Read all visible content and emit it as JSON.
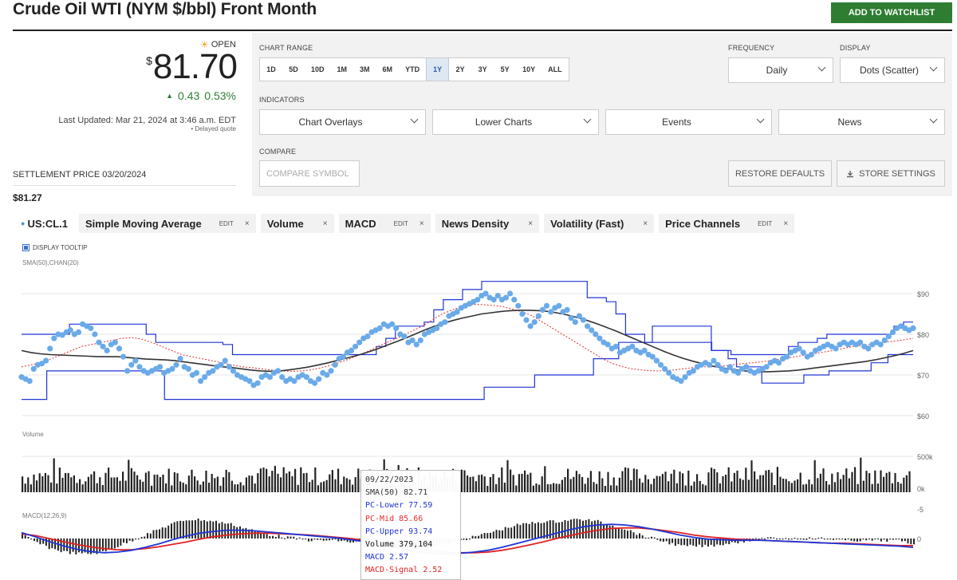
{
  "header": {
    "title": "Crude Oil WTI (NYM $/bbl) Front Month",
    "watchlist_label": "ADD TO WATCHLIST"
  },
  "quote": {
    "status": "OPEN",
    "currency": "$",
    "price": "81.70",
    "change": "0.43",
    "change_pct": "0.53%",
    "updated": "Last Updated: Mar 21, 2024 at 3:46 a.m. EDT",
    "delayed": "Delayed quote",
    "settlement_label": "SETTLEMENT PRICE 03/20/2024",
    "settlement_value": "$81.27"
  },
  "panel": {
    "chart_range_label": "CHART RANGE",
    "ranges": [
      "1D",
      "5D",
      "10D",
      "1M",
      "3M",
      "6M",
      "YTD",
      "1Y",
      "2Y",
      "3Y",
      "5Y",
      "10Y",
      "ALL"
    ],
    "selected_range": "1Y",
    "frequency_label": "FREQUENCY",
    "frequency_value": "Daily",
    "display_label": "DISPLAY",
    "display_value": "Dots (Scatter)",
    "indicators_label": "INDICATORS",
    "indicators": [
      "Chart Overlays",
      "Lower Charts",
      "Events",
      "News"
    ],
    "compare_label": "COMPARE",
    "compare_placeholder": "COMPARE SYMBOL",
    "restore_label": "RESTORE DEFAULTS",
    "store_label": "STORE SETTINGS"
  },
  "legend": {
    "symbol": "US:CL.1",
    "items": [
      {
        "label": "Simple Moving Average",
        "edit": true
      },
      {
        "label": "Volume",
        "edit": false
      },
      {
        "label": "MACD",
        "edit": true
      },
      {
        "label": "News Density",
        "edit": false
      },
      {
        "label": "Volatility (Fast)",
        "edit": false
      },
      {
        "label": "Price Channels",
        "edit": true
      }
    ],
    "edit_label": "EDIT",
    "close_label": "×"
  },
  "tooltip_toggle": "DISPLAY TOOLTIP",
  "panes": {
    "price_label": "SMA(50),CHAN(20)",
    "volume_label": "Volume",
    "macd_label": "MACD(12,26,9)"
  },
  "tooltip": {
    "date": "09/22/2023",
    "sma": "SMA(50)  82.71",
    "pc_lower": "PC-Lower  77.59",
    "pc_mid": "PC-Mid  85.66",
    "pc_upper": "PC-Upper  93.74",
    "volume": "Volume  379,104",
    "macd": "MACD  2.57",
    "macd_signal": "MACD-Signal  2.52"
  },
  "colors": {
    "accent_green": "#2e7d32",
    "dots": "#6aaae8",
    "channel": "#1f35d6",
    "mid": "#e03030",
    "sma": "#333333",
    "macd": "#1f35d6",
    "signal": "#e02020"
  },
  "chart_data": [
    {
      "type": "scatter",
      "title": "SMA(50),CHAN(20)",
      "ylim": [
        60,
        95
      ],
      "y_ticks": [
        "$90",
        "$80",
        "$70",
        "$60"
      ],
      "y_tick_values": [
        90,
        80,
        70,
        60
      ],
      "series": [
        {
          "values": [
            69.5,
            69.0,
            68.5,
            71.5,
            72.5,
            72.8,
            73.5,
            76.5,
            79.0,
            80.0,
            79.8,
            80.5,
            81.0,
            80.0,
            80.5,
            82.5,
            82.0,
            81.5,
            80.0,
            78.0,
            77.0,
            76.0,
            77.5,
            78.0,
            76.5,
            74.5,
            71.0,
            72.5,
            73.5,
            72.0,
            71.0,
            70.5,
            71.0,
            71.5,
            72.0,
            70.5,
            71.0,
            71.5,
            72.5,
            74.0,
            72.0,
            71.5,
            70.0,
            70.5,
            68.5,
            69.5,
            70.5,
            71.0,
            72.0,
            72.5,
            73.5,
            72.0,
            71.0,
            70.0,
            69.5,
            69.0,
            68.5,
            67.5,
            68.0,
            69.5,
            70.0,
            69.5,
            70.5,
            71.0,
            69.5,
            68.5,
            69.0,
            68.5,
            69.5,
            70.0,
            69.5,
            68.5,
            68.0,
            69.0,
            70.5,
            70.0,
            71.0,
            72.5,
            74.0,
            74.5,
            75.5,
            76.0,
            77.0,
            78.0,
            79.0,
            79.5,
            80.5,
            81.0,
            81.5,
            82.5,
            82.0,
            82.5,
            81.5,
            80.0,
            79.5,
            78.0,
            78.5,
            77.5,
            78.5,
            80.0,
            80.5,
            81.0,
            81.5,
            82.5,
            83.0,
            84.5,
            85.0,
            85.5,
            86.5,
            87.0,
            87.5,
            88.0,
            88.5,
            89.5,
            90.0,
            89.0,
            88.5,
            89.5,
            88.5,
            89.0,
            90.0,
            88.5,
            87.0,
            85.0,
            83.5,
            82.0,
            83.0,
            84.5,
            86.0,
            87.0,
            85.5,
            86.5,
            87.0,
            85.5,
            86.0,
            84.0,
            83.0,
            84.5,
            83.5,
            82.0,
            81.0,
            80.0,
            79.0,
            78.0,
            77.5,
            76.5,
            77.0,
            75.5,
            76.0,
            76.5,
            77.0,
            76.0,
            75.5,
            76.0,
            75.0,
            74.5,
            73.5,
            72.5,
            71.5,
            70.5,
            69.5,
            69.0,
            68.5,
            69.5,
            70.5,
            71.0,
            72.0,
            72.5,
            73.0,
            72.5,
            73.5,
            72.5,
            71.5,
            71.0,
            72.0,
            71.0,
            70.5,
            71.5,
            72.0,
            71.0,
            70.5,
            71.0,
            71.5,
            72.0,
            73.0,
            73.5,
            73.0,
            74.0,
            74.5,
            75.5,
            76.0,
            76.5,
            75.5,
            74.5,
            75.0,
            76.0,
            76.5,
            77.0,
            77.5,
            77.0,
            76.5,
            77.5,
            78.0,
            77.5,
            78.0,
            77.5,
            78.0,
            77.0,
            76.5,
            77.5,
            78.0,
            77.5,
            78.5,
            79.5,
            80.5,
            81.5,
            82.0,
            81.5,
            81.0,
            81.5
          ]
        },
        {
          "name": "SMA(50)",
          "values": [
            76,
            75.5,
            75.2,
            75,
            74.9,
            74.8,
            74.7,
            74.6,
            74.5,
            74.5,
            74.5,
            74.3,
            74.1,
            73.9,
            73.8,
            73.7,
            73.5,
            73.2,
            72.9,
            72.6,
            72.3,
            72,
            71.8,
            71.5,
            71.2,
            71,
            70.9,
            71,
            71.3,
            71.6,
            72,
            72.5,
            73,
            73.6,
            74.2,
            74.8,
            75.5,
            76.3,
            77.2,
            78.1,
            79,
            80,
            81,
            81.9,
            82.7,
            83.4,
            84,
            84.5,
            85,
            85.3,
            85.6,
            85.8,
            85.9,
            85.9,
            85.8,
            85.6,
            85.2,
            84.7,
            84.1,
            83.4,
            82.6,
            81.7,
            80.8,
            79.8,
            78.8,
            77.8,
            76.8,
            75.8,
            74.9,
            74.1,
            73.4,
            72.8,
            72.2,
            71.8,
            71.4,
            71.1,
            70.9,
            70.8,
            70.8,
            70.9,
            71,
            71.2,
            71.5,
            71.8,
            72.1,
            72.4,
            72.7,
            73,
            73.3,
            73.7,
            74.2,
            74.7,
            75.3,
            76
          ]
        },
        {
          "name": "PC-Mid",
          "values": [
            72,
            72.5,
            73,
            74,
            75,
            76,
            77,
            77.5,
            78,
            78.5,
            79,
            79.2,
            78.8,
            78,
            77,
            76,
            75,
            74.5,
            74,
            73.5,
            73,
            72.5,
            72,
            71.8,
            71.5,
            71.2,
            71,
            70.9,
            71,
            71.3,
            71.8,
            72.5,
            73.3,
            74.2,
            75.2,
            76.3,
            77.5,
            78.5,
            79.6,
            80.8,
            82,
            83.5,
            85,
            86,
            86.8,
            87.3,
            87.3,
            87.1,
            86.8,
            86.2,
            85.5,
            84.5,
            83,
            81.5,
            80,
            78.5,
            77,
            75.5,
            74,
            72.8,
            72,
            71.5,
            71.2,
            71,
            71,
            71.2,
            71.5,
            71.8,
            72,
            72,
            72.2,
            72.5,
            72.8,
            73,
            73.3,
            73.6,
            74,
            74.4,
            74.8,
            75.2,
            75.6,
            76,
            76.5,
            77,
            77.3,
            77.6,
            78,
            78.3,
            78.6,
            79
          ]
        },
        {
          "name": "PC-Upper",
          "values": [
            80,
            80,
            80,
            80,
            80,
            82.5,
            82.5,
            82.5,
            82.5,
            82.5,
            82.5,
            82.5,
            82.5,
            80,
            78,
            78,
            78,
            78,
            78,
            78,
            78,
            77.5,
            75,
            75,
            75,
            75,
            75,
            75,
            75,
            75,
            75,
            75,
            75,
            75,
            75,
            75,
            75,
            77,
            79,
            82,
            82,
            82,
            83,
            86,
            88.5,
            88.5,
            91,
            91,
            93,
            93,
            93,
            93,
            93,
            93,
            93,
            93,
            93,
            93,
            93,
            89,
            89,
            88,
            85,
            80,
            80,
            78,
            78,
            78,
            78,
            78,
            78,
            78,
            76,
            76,
            75,
            75,
            75,
            75,
            75,
            75,
            77,
            78,
            78,
            79,
            80,
            80,
            80,
            80,
            80,
            80,
            80,
            82,
            83,
            83
          ]
        },
        {
          "name": "PC-Lower",
          "values": [
            64,
            64,
            64,
            71,
            71,
            71,
            71,
            71,
            71,
            71,
            71,
            71,
            71,
            71,
            71,
            71,
            71,
            64,
            64,
            64,
            64,
            64,
            64,
            64,
            64,
            64,
            64,
            64,
            64,
            64,
            64,
            64,
            64,
            64,
            64,
            64,
            64,
            64,
            64,
            64,
            64,
            64,
            64,
            64,
            64,
            64,
            64,
            64,
            64,
            64,
            64,
            64,
            64,
            64,
            64,
            67,
            67,
            67,
            67,
            67,
            67,
            70,
            70,
            70,
            70,
            70,
            70,
            70,
            74,
            74,
            74,
            78,
            78,
            78,
            78,
            82,
            82,
            82,
            82,
            82,
            82,
            82,
            76,
            76,
            74,
            72,
            72,
            72,
            68,
            68,
            68,
            68,
            68,
            70,
            70,
            70,
            71,
            71,
            71,
            71,
            71,
            73,
            73,
            75,
            75,
            75,
            75
          ]
        }
      ]
    },
    {
      "type": "bar",
      "title": "Volume",
      "y_ticks": [
        "500k",
        "0k"
      ],
      "y_tick_values": [
        500000,
        0
      ]
    },
    {
      "type": "line",
      "title": "MACD(12,26,9)",
      "y_ticks": [
        "0",
        "-5"
      ],
      "y_tick_values": [
        0,
        -5
      ],
      "series": [
        {
          "name": "MACD",
          "values": [
            -1,
            -0.3,
            0.5,
            1.2,
            1.8,
            2.2,
            2.4,
            2.3,
            2,
            1.5,
            0.9,
            0.2,
            -0.4,
            -0.9,
            -1.2,
            -1.4,
            -1.4,
            -1.3,
            -1.1,
            -0.9,
            -0.7,
            -0.5,
            -0.3,
            -0.1,
            0.2,
            0.5,
            0.9,
            1.4,
            1.9,
            2.3,
            2.5,
            2.6,
            2.5,
            2.3,
            2,
            1.5,
            0.9,
            0.3,
            -0.3,
            -0.9,
            -1.5,
            -2,
            -2.3,
            -2.4,
            -2.3,
            -2,
            -1.6,
            -1.1,
            -0.6,
            -0.2,
            0.1,
            0.2,
            0.3,
            0.3,
            0.3,
            0.4,
            0.5,
            0.6,
            0.7,
            0.8,
            0.9,
            1,
            1.1,
            1.2,
            1.3,
            1.5
          ]
        },
        {
          "name": "MACD-Signal",
          "values": [
            -0.8,
            -0.5,
            0,
            0.5,
            1,
            1.4,
            1.7,
            1.9,
            1.9,
            1.7,
            1.4,
            1,
            0.6,
            0.1,
            -0.3,
            -0.6,
            -0.8,
            -0.9,
            -0.9,
            -0.8,
            -0.7,
            -0.6,
            -0.4,
            -0.2,
            0,
            0.3,
            0.6,
            1,
            1.4,
            1.8,
            2.1,
            2.3,
            2.4,
            2.4,
            2.3,
            2,
            1.6,
            1.1,
            0.6,
            0,
            -0.5,
            -1,
            -1.4,
            -1.7,
            -1.8,
            -1.8,
            -1.6,
            -1.3,
            -1,
            -0.6,
            -0.3,
            -0.1,
            0.1,
            0.2,
            0.3,
            0.4,
            0.5,
            0.6,
            0.7,
            0.8,
            0.8,
            0.9,
            1,
            1.1,
            1.2,
            1.2
          ]
        }
      ]
    }
  ]
}
